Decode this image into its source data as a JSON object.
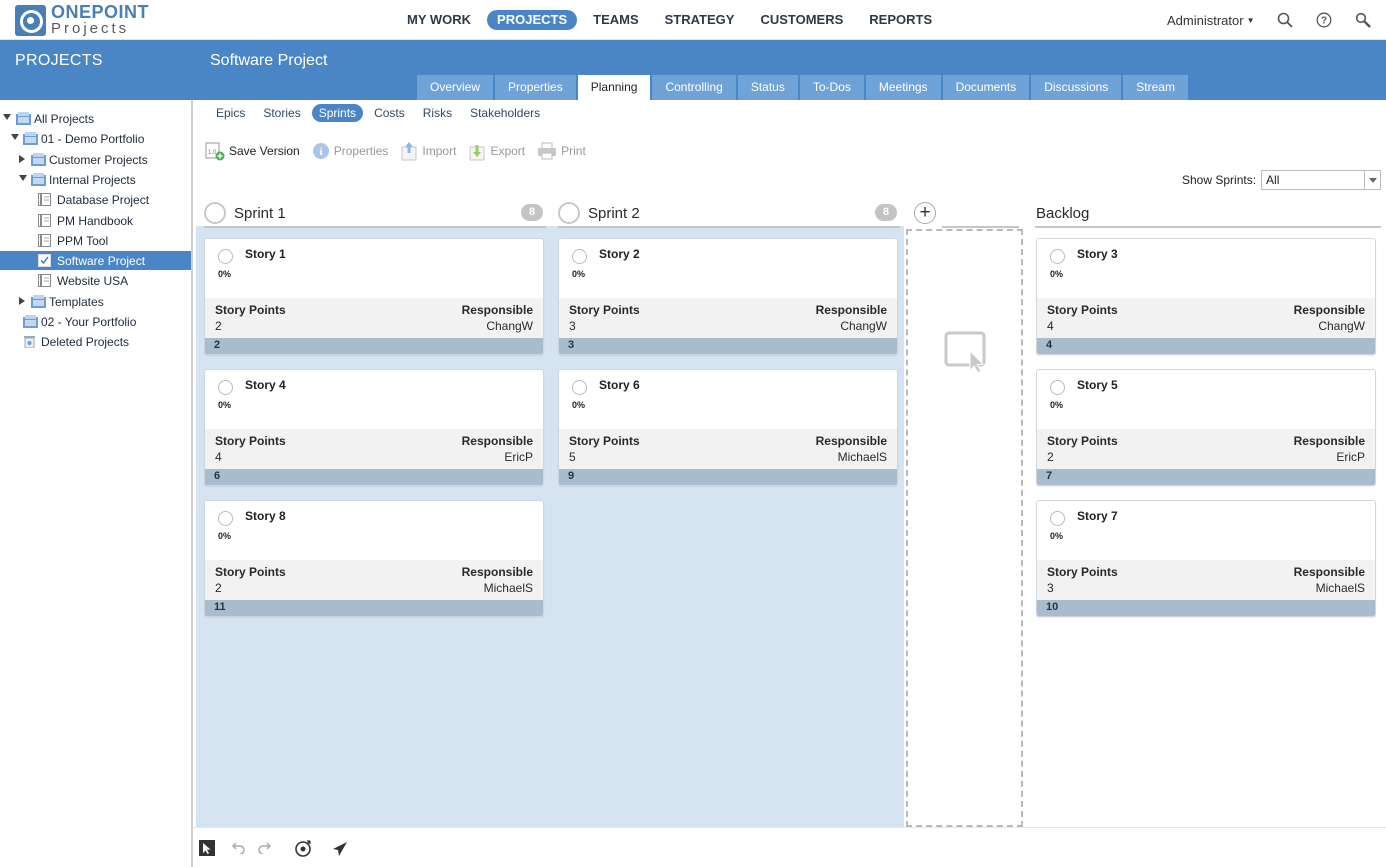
{
  "app": {
    "logo_line1": "ONEPOINT",
    "logo_line2": "Projects"
  },
  "mainnav": [
    "MY WORK",
    "PROJECTS",
    "TEAMS",
    "STRATEGY",
    "CUSTOMERS",
    "REPORTS"
  ],
  "user": {
    "name": "Administrator"
  },
  "sidebar": {
    "title": "PROJECTS",
    "tree": [
      {
        "label": "All Projects",
        "toggle": "open",
        "icon": "portfolio-icon",
        "depth": 0,
        "selected": false
      },
      {
        "label": "01 - Demo Portfolio",
        "toggle": "open",
        "icon": "portfolio-icon",
        "depth": 1,
        "selected": false
      },
      {
        "label": "Customer Projects",
        "toggle": "closed",
        "icon": "portfolio-icon",
        "depth": 2,
        "selected": false
      },
      {
        "label": "Internal Projects",
        "toggle": "open",
        "icon": "portfolio-icon",
        "depth": 2,
        "selected": false
      },
      {
        "label": "Database Project",
        "toggle": "none",
        "icon": "project-icon",
        "depth": 3,
        "selected": false
      },
      {
        "label": "PM Handbook",
        "toggle": "none",
        "icon": "project-icon",
        "depth": 3,
        "selected": false
      },
      {
        "label": "PPM Tool",
        "toggle": "none",
        "icon": "project-icon",
        "depth": 3,
        "selected": false
      },
      {
        "label": "Software Project",
        "toggle": "none",
        "icon": "project-icon",
        "depth": 3,
        "selected": true
      },
      {
        "label": "Website USA",
        "toggle": "none",
        "icon": "project-icon",
        "depth": 3,
        "selected": false
      },
      {
        "label": "Templates",
        "toggle": "closed",
        "icon": "portfolio-icon",
        "depth": 2,
        "selected": false
      },
      {
        "label": "02 - Your Portfolio",
        "toggle": "none",
        "icon": "portfolio-icon",
        "depth": 1,
        "selected": false
      },
      {
        "label": "Deleted Projects",
        "toggle": "none",
        "icon": "trash-icon",
        "depth": 1,
        "selected": false
      }
    ]
  },
  "project": {
    "title": "Software Project",
    "tabs": [
      "Overview",
      "Properties",
      "Planning",
      "Controlling",
      "Status",
      "To-Dos",
      "Meetings",
      "Documents",
      "Discussions",
      "Stream"
    ],
    "active_tab": "Planning",
    "subtabs": [
      "Epics",
      "Stories",
      "Sprints",
      "Costs",
      "Risks",
      "Stakeholders"
    ],
    "active_subtab": "Sprints"
  },
  "toolbar": {
    "save_version": "Save Version",
    "properties": "Properties",
    "import": "Import",
    "export": "Export",
    "print": "Print"
  },
  "filter": {
    "label": "Show Sprints:",
    "value": "All"
  },
  "labels": {
    "story_points": "Story Points",
    "responsible": "Responsible"
  },
  "columns": [
    {
      "title": "Sprint 1",
      "count": "8",
      "cards": [
        {
          "title": "Story 1",
          "progress": "0%",
          "points": "2",
          "responsible": "ChangW",
          "id": "2"
        },
        {
          "title": "Story 4",
          "progress": "0%",
          "points": "4",
          "responsible": "EricP",
          "id": "6"
        },
        {
          "title": "Story 8",
          "progress": "0%",
          "points": "2",
          "responsible": "MichaelS",
          "id": "11"
        }
      ]
    },
    {
      "title": "Sprint 2",
      "count": "8",
      "cards": [
        {
          "title": "Story 2",
          "progress": "0%",
          "points": "3",
          "responsible": "ChangW",
          "id": "3"
        },
        {
          "title": "Story 6",
          "progress": "0%",
          "points": "5",
          "responsible": "MichaelS",
          "id": "9"
        }
      ]
    },
    {
      "title": "Backlog",
      "count": "",
      "cards": [
        {
          "title": "Story 3",
          "progress": "0%",
          "points": "4",
          "responsible": "ChangW",
          "id": "4"
        },
        {
          "title": "Story 5",
          "progress": "0%",
          "points": "2",
          "responsible": "EricP",
          "id": "7"
        },
        {
          "title": "Story 7",
          "progress": "0%",
          "points": "3",
          "responsible": "MichaelS",
          "id": "10"
        }
      ]
    }
  ],
  "colors": {
    "brand_blue": "#4a86c5",
    "tab_blue": "#6fa3d8",
    "board_background": "#d6e4f2",
    "card_footer": "#a9bccd"
  }
}
